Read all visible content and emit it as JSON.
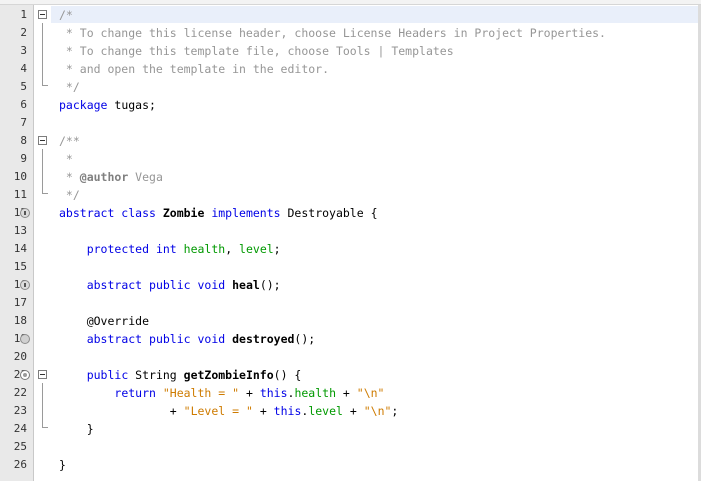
{
  "editor": {
    "lines": [
      {
        "n": "1",
        "segs": [
          {
            "t": "/*",
            "c": "cm"
          }
        ]
      },
      {
        "n": "2",
        "segs": [
          {
            "t": " * To change this license header, choose License Headers in Project Properties.",
            "c": "cm"
          }
        ]
      },
      {
        "n": "3",
        "segs": [
          {
            "t": " * To change this template file, choose Tools | Templates",
            "c": "cm"
          }
        ]
      },
      {
        "n": "4",
        "segs": [
          {
            "t": " * and open the template in the editor.",
            "c": "cm"
          }
        ]
      },
      {
        "n": "5",
        "segs": [
          {
            "t": " */",
            "c": "cm"
          }
        ]
      },
      {
        "n": "6",
        "segs": [
          {
            "t": "package",
            "c": "kw"
          },
          {
            "t": " tugas;",
            "c": ""
          }
        ]
      },
      {
        "n": "7",
        "segs": []
      },
      {
        "n": "8",
        "segs": [
          {
            "t": "/**",
            "c": "cm"
          }
        ]
      },
      {
        "n": "9",
        "segs": [
          {
            "t": " *",
            "c": "cm"
          }
        ]
      },
      {
        "n": "10",
        "segs": [
          {
            "t": " * ",
            "c": "cm"
          },
          {
            "t": "@author",
            "c": "tag"
          },
          {
            "t": " Vega",
            "c": "cm"
          }
        ]
      },
      {
        "n": "11",
        "segs": [
          {
            "t": " */",
            "c": "cm"
          }
        ]
      },
      {
        "n": "12",
        "segs": [
          {
            "t": "abstract class ",
            "c": "kw"
          },
          {
            "t": "Zombie",
            "c": "b"
          },
          {
            "t": " implements ",
            "c": "kw"
          },
          {
            "t": "Destroyable {",
            "c": ""
          }
        ]
      },
      {
        "n": "13",
        "segs": []
      },
      {
        "n": "14",
        "segs": [
          {
            "t": "    ",
            "c": ""
          },
          {
            "t": "protected int ",
            "c": "kw"
          },
          {
            "t": "health",
            "c": "fld"
          },
          {
            "t": ", ",
            "c": ""
          },
          {
            "t": "level",
            "c": "fld"
          },
          {
            "t": ";",
            "c": ""
          }
        ]
      },
      {
        "n": "15",
        "segs": []
      },
      {
        "n": "16",
        "segs": [
          {
            "t": "    ",
            "c": ""
          },
          {
            "t": "abstract public void ",
            "c": "kw"
          },
          {
            "t": "heal",
            "c": "b"
          },
          {
            "t": "();",
            "c": ""
          }
        ]
      },
      {
        "n": "17",
        "segs": []
      },
      {
        "n": "18",
        "segs": [
          {
            "t": "    @Override",
            "c": "ann-txt"
          }
        ]
      },
      {
        "n": "19",
        "segs": [
          {
            "t": "    ",
            "c": ""
          },
          {
            "t": "abstract public void ",
            "c": "kw"
          },
          {
            "t": "destroyed",
            "c": "b"
          },
          {
            "t": "();",
            "c": ""
          }
        ]
      },
      {
        "n": "20",
        "segs": []
      },
      {
        "n": "21",
        "segs": [
          {
            "t": "    ",
            "c": ""
          },
          {
            "t": "public ",
            "c": "kw"
          },
          {
            "t": "String ",
            "c": ""
          },
          {
            "t": "getZombieInfo",
            "c": "b"
          },
          {
            "t": "() {",
            "c": ""
          }
        ]
      },
      {
        "n": "22",
        "segs": [
          {
            "t": "        ",
            "c": ""
          },
          {
            "t": "return ",
            "c": "kw"
          },
          {
            "t": "\"Health = \"",
            "c": "str"
          },
          {
            "t": " + ",
            "c": ""
          },
          {
            "t": "this",
            "c": "kw"
          },
          {
            "t": ".",
            "c": ""
          },
          {
            "t": "health",
            "c": "fld"
          },
          {
            "t": " + ",
            "c": ""
          },
          {
            "t": "\"\\n\"",
            "c": "str"
          }
        ]
      },
      {
        "n": "23",
        "segs": [
          {
            "t": "                ",
            "c": ""
          },
          {
            "t": "+ ",
            "c": ""
          },
          {
            "t": "\"Level = \"",
            "c": "str"
          },
          {
            "t": " + ",
            "c": ""
          },
          {
            "t": "this",
            "c": "kw"
          },
          {
            "t": ".",
            "c": ""
          },
          {
            "t": "level",
            "c": "fld"
          },
          {
            "t": " + ",
            "c": ""
          },
          {
            "t": "\"\\n\"",
            "c": "str"
          },
          {
            "t": ";",
            "c": ""
          }
        ]
      },
      {
        "n": "24",
        "segs": [
          {
            "t": "    }",
            "c": ""
          }
        ]
      },
      {
        "n": "25",
        "segs": []
      },
      {
        "n": "26",
        "segs": [
          {
            "t": "}",
            "c": ""
          }
        ]
      }
    ],
    "annotations": {
      "12": "implements-icon",
      "16": "implements-icon",
      "19": "override-icon",
      "21": "override-icon"
    },
    "folds": [
      "1",
      "8",
      "21"
    ],
    "colors": {
      "comment": "#969696",
      "keyword": "#0000e6",
      "field": "#009900",
      "string": "#ce7b00",
      "gutter": "#e9e9e9",
      "current_line": "#e9effa"
    }
  }
}
